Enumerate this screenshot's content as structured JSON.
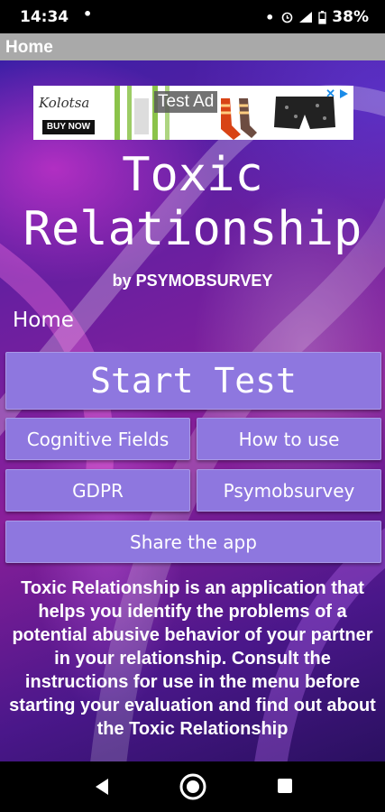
{
  "status_bar": {
    "time": "14:34",
    "battery": "38%"
  },
  "app_bar": {
    "title": "Home"
  },
  "ad": {
    "brand": "Kolotsa",
    "buy_now": "BUY NOW",
    "label": "Test Ad"
  },
  "header": {
    "title_line1": "Toxic",
    "title_line2": "Relationship",
    "byline": "by PSYMOBSURVEY",
    "section": "Home"
  },
  "buttons": {
    "start": "Start Test",
    "cognitive": "Cognitive Fields",
    "how_to_use": "How to use",
    "gdpr": "GDPR",
    "psymobsurvey": "Psymobsurvey",
    "share": "Share the app"
  },
  "description": "Toxic Relationship is an application that helps you identify the problems of a potential abusive behavior of your partner in your relationship. Consult the instructions for use in the menu before starting your evaluation and find out about the Toxic Relationship"
}
